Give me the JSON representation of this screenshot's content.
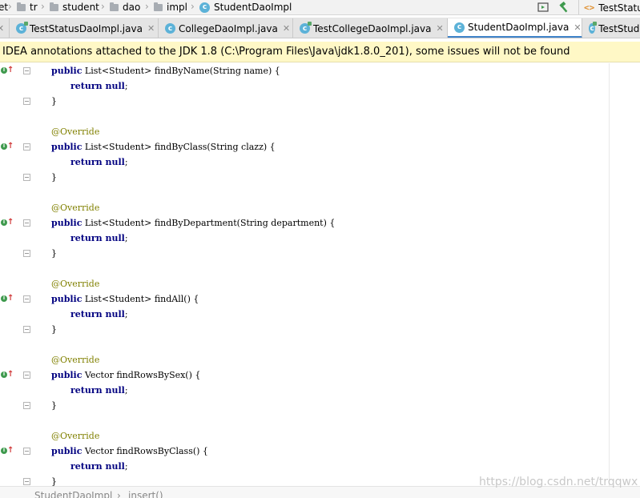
{
  "breadcrumb": {
    "items": [
      "et",
      "tr",
      "student",
      "dao",
      "impl",
      "StudentDaoImpl"
    ],
    "class_icon_letter": "c"
  },
  "toolbar": {
    "run_config": "TestStatu"
  },
  "tabs": [
    {
      "label": "TestStatusDaoImpl.java",
      "active": false,
      "test": true
    },
    {
      "label": "CollegeDaoImpl.java",
      "active": false,
      "test": false
    },
    {
      "label": "TestCollegeDaoImpl.java",
      "active": false,
      "test": true
    },
    {
      "label": "StudentDaoImpl.java",
      "active": true,
      "test": false
    },
    {
      "label": "TestStudu",
      "active": false,
      "test": true
    }
  ],
  "notice": {
    "text": "IDEA annotations attached to the JDK 1.8 (C:\\Program Files\\Java\\jdk1.8.0_201), some issues will not be found"
  },
  "editor": {
    "blocks": [
      {
        "annotation": "",
        "signature": [
          "public",
          " List<Student> findByName(String name) {"
        ],
        "body": [
          "return",
          " null",
          ";"
        ],
        "close": "}"
      },
      {
        "annotation": "@Override",
        "signature": [
          "public",
          " List<Student> findByClass(String clazz) {"
        ],
        "body": [
          "return",
          " null",
          ";"
        ],
        "close": "}"
      },
      {
        "annotation": "@Override",
        "signature": [
          "public",
          " List<Student> findByDepartment(String department) {"
        ],
        "body": [
          "return",
          " null",
          ";"
        ],
        "close": "}"
      },
      {
        "annotation": "@Override",
        "signature": [
          "public",
          " List<Student> findAll() {"
        ],
        "body": [
          "return",
          " null",
          ";"
        ],
        "close": "}"
      },
      {
        "annotation": "@Override",
        "signature": [
          "public",
          " Vector findRowsBySex() {"
        ],
        "body": [
          "return",
          " null",
          ";"
        ],
        "close": "}"
      },
      {
        "annotation": "@Override",
        "signature": [
          "public",
          " Vector findRowsByClass() {"
        ],
        "body": [
          "return",
          " null",
          ";"
        ],
        "close": "}"
      }
    ]
  },
  "status_breadcrumb": {
    "items": [
      "StudentDaoImpl",
      "insert()"
    ]
  },
  "watermark": "https://blog.csdn.net/trqqwx",
  "colors": {
    "keyword": "#000080",
    "annotation": "#808000",
    "notice_bg": "#fff8c6",
    "active_tab_underline": "#4083c9"
  }
}
